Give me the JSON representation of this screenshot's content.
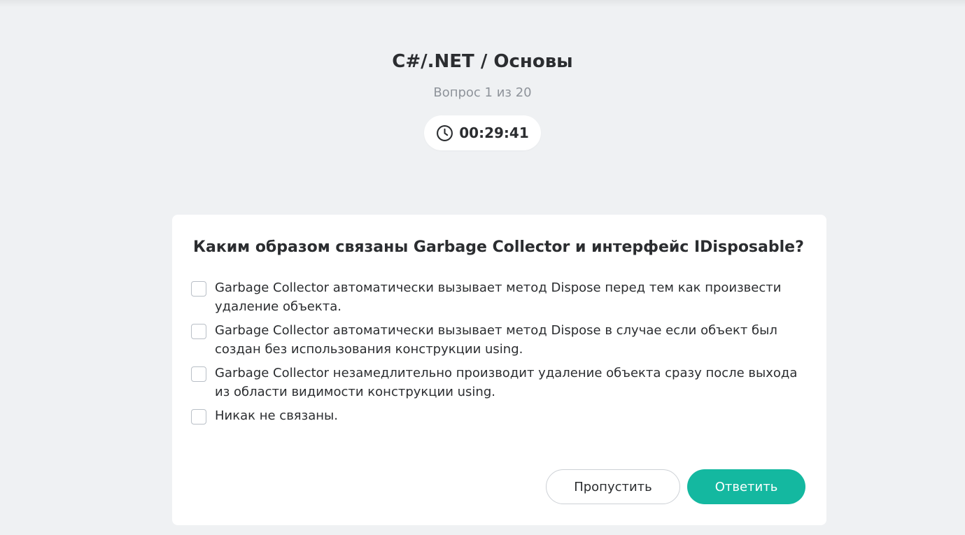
{
  "header": {
    "title": "C#/.NET / Основы",
    "progress": "Вопрос 1 из 20",
    "timer": "00:29:41",
    "timer_icon": "clock-icon"
  },
  "question": {
    "text": "Каким образом связаны Garbage Collector и интерфейс IDisposable?",
    "options": [
      {
        "label": "Garbage Collector автоматически вызывает метод Dispose перед тем как произвести удаление объекта.",
        "checked": false
      },
      {
        "label": "Garbage Collector автоматически вызывает метод Dispose в случае если объект был создан без использования конструкции using.",
        "checked": false
      },
      {
        "label": "Garbage Collector незамедлительно производит удаление объекта сразу после выхода из области видимости конструкции using.",
        "checked": false
      },
      {
        "label": "Никак не связаны.",
        "checked": false
      }
    ]
  },
  "actions": {
    "skip_label": "Пропустить",
    "answer_label": "Ответить"
  },
  "colors": {
    "background": "#eff1f3",
    "accent": "#14b8a0",
    "text": "#2b2d30",
    "muted": "#8e939a"
  }
}
